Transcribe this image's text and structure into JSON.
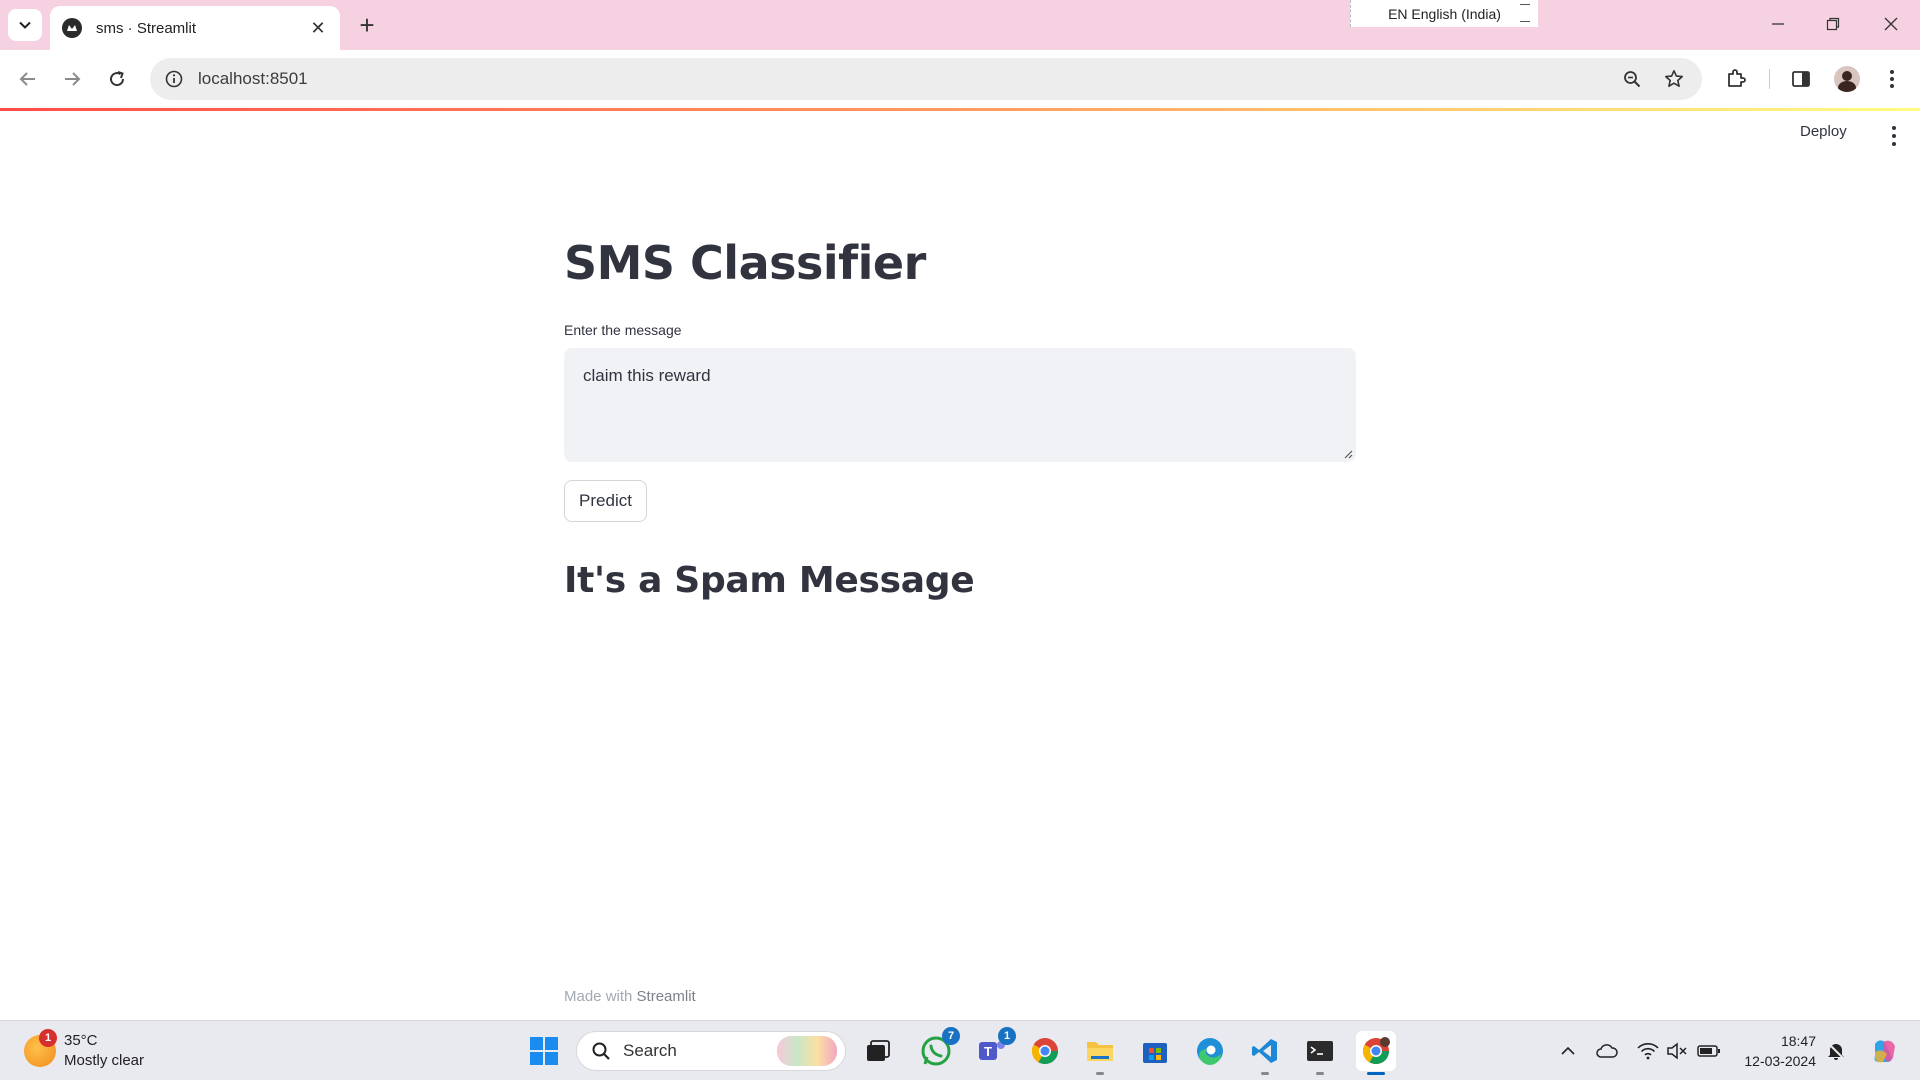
{
  "browser": {
    "tab_title": "sms · Streamlit",
    "address_url": "localhost:8501",
    "language_indicator": "EN English (India)"
  },
  "app": {
    "deploy_label": "Deploy",
    "title": "SMS Classifier",
    "input_label": "Enter the message",
    "message_value": "claim this reward",
    "predict_label": "Predict",
    "result_text": "It's a Spam Message",
    "footer_prefix": "Made with",
    "footer_brand": "Streamlit"
  },
  "taskbar": {
    "weather_temp": "35°C",
    "weather_desc": "Mostly clear",
    "weather_badge": "1",
    "search_label": "Search",
    "whatsapp_badge": "7",
    "teams_badge": "1",
    "time": "18:47",
    "date": "12-03-2024"
  },
  "colors": {
    "accent_red": "#ff4b4b",
    "text_primary": "#31333f",
    "input_bg": "#f0f2f6",
    "tabbar_bg": "#f5d1e2"
  }
}
